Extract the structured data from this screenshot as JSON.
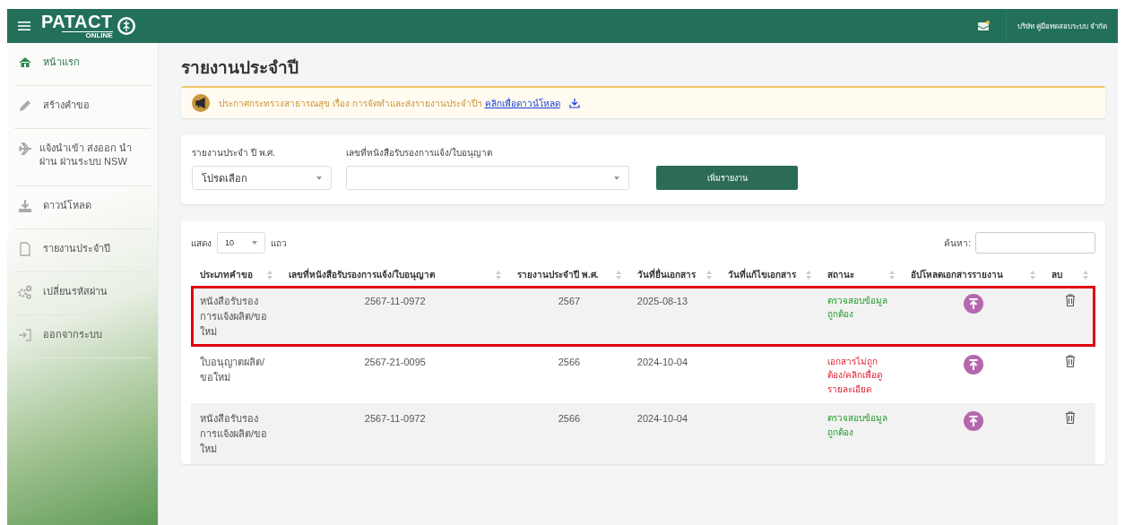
{
  "header": {
    "logo": {
      "title": "PATACT",
      "subtitle": "ONLINE"
    },
    "user": "บริษัท คู่มือทดสอบระบบ จำกัด"
  },
  "sidebar": {
    "items": [
      {
        "label": "หน้าแรก",
        "kind": "home",
        "selected": true
      },
      {
        "label": "สร้างคำขอ",
        "kind": "pencil",
        "selected": false
      },
      {
        "label": "แจ้งนำเข้า ส่งออก นำผ่าน ผ่านระบบ NSW",
        "kind": "plane",
        "selected": false
      },
      {
        "label": "ดาวน์โหลด",
        "kind": "download",
        "selected": false
      },
      {
        "label": "รายงานประจำปี",
        "kind": "file",
        "selected": false
      },
      {
        "label": "เปลี่ยนรหัสผ่าน",
        "kind": "gears",
        "selected": false
      },
      {
        "label": "ออกจากระบบ",
        "kind": "logout",
        "selected": false
      }
    ]
  },
  "page_title": "รายงานประจำปี",
  "notice": {
    "text": "ประกาศกระทรวงสาธารณสุข เรื่อง การจัดทำและส่งรายงานประจำปีฯ",
    "link": "คลิกเพื่อดาวน์โหลด"
  },
  "filters": {
    "year": {
      "label": "รายงานประจำ ปี พ.ศ.",
      "value": "โปรดเลือก"
    },
    "license": {
      "label": "เลขที่หนังสือรับรองการแจ้ง/ใบอนุญาต"
    },
    "button": "เพิ่มรายงาน"
  },
  "table": {
    "length": {
      "prefix": "แสดง",
      "value": "10",
      "suffix": "แถว"
    },
    "search": {
      "label": "ค้นหา:"
    },
    "columns": [
      "ประเภทคำขอ",
      "เลขที่หนังสือรับรองการแจ้ง/ใบอนุญาต",
      "รายงานประจำปี พ.ศ.",
      "วันที่ยื่นเอกสาร",
      "วันที่แก้ไขเอกสาร",
      "สถานะ",
      "อัปโหลดเอกสารรายงาน",
      "ลบ"
    ],
    "rows": [
      {
        "type": "หนังสือรับรองการแจ้งผลิต/ขอใหม่",
        "license_no": "2567-11-0972",
        "year": "2567",
        "submitted": "2025-08-13",
        "status": "ตรวจสอบข้อมูลถูกต้อง",
        "kind": "ok",
        "highlighted": true
      },
      {
        "type": "ใบอนุญาตผลิต/ขอใหม่",
        "license_no": "2567-21-0095",
        "year": "2566",
        "submitted": "2024-10-04",
        "status": "เอกสารไม่ถูกต้อง/คลิกเพื่อดูรายละเอียด",
        "kind": "error",
        "highlighted": false
      },
      {
        "type": "หนังสือรับรองการแจ้งผลิต/ขอใหม่",
        "license_no": "2567-11-0972",
        "year": "2566",
        "submitted": "2024-10-04",
        "status": "ตรวจสอบข้อมูลถูกต้อง",
        "kind": "ok",
        "highlighted": false
      }
    ]
  }
}
